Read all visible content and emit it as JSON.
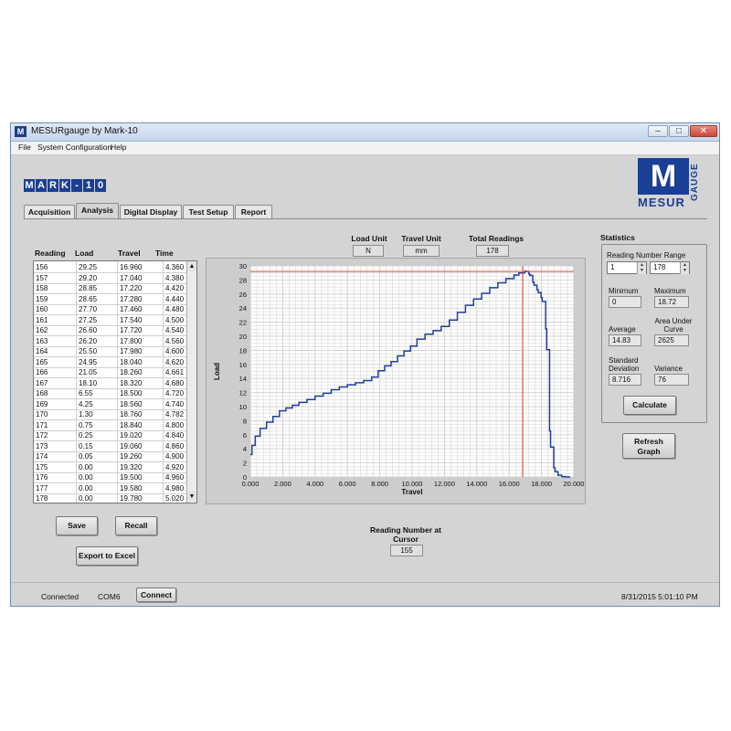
{
  "window": {
    "title": "MESURgauge by Mark-10"
  },
  "window_controls": {
    "minimize": "–",
    "maximize": "□",
    "close": "✕"
  },
  "menu": [
    "File",
    "System Configuration",
    "Help"
  ],
  "logos": {
    "mark10": [
      "M",
      "A",
      "R",
      "K",
      "-",
      "1",
      "0"
    ],
    "mesur_letter": "M",
    "mesur_word": "MESUR",
    "gauge_word": "GAUGE"
  },
  "tabs": [
    {
      "label": "Acquisition",
      "active": false
    },
    {
      "label": "Analysis",
      "active": true
    },
    {
      "label": "Digital Display",
      "active": false
    },
    {
      "label": "Test Setup",
      "active": false
    },
    {
      "label": "Report",
      "active": false
    }
  ],
  "table": {
    "headers": [
      "Reading",
      "Load",
      "Travel",
      "Time"
    ],
    "rows": [
      [
        "156",
        "29.25",
        "16.960",
        "4.360"
      ],
      [
        "157",
        "29.20",
        "17.040",
        "4.380"
      ],
      [
        "158",
        "28.85",
        "17.220",
        "4.420"
      ],
      [
        "159",
        "28.65",
        "17.280",
        "4.440"
      ],
      [
        "160",
        "27.70",
        "17.460",
        "4.480"
      ],
      [
        "161",
        "27.25",
        "17.540",
        "4.500"
      ],
      [
        "162",
        "26.60",
        "17.720",
        "4.540"
      ],
      [
        "163",
        "26.20",
        "17.800",
        "4.560"
      ],
      [
        "164",
        "25.50",
        "17.980",
        "4.600"
      ],
      [
        "165",
        "24.95",
        "18.040",
        "4.620"
      ],
      [
        "166",
        "21.05",
        "18.260",
        "4.661"
      ],
      [
        "167",
        "18.10",
        "18.320",
        "4.680"
      ],
      [
        "168",
        "6.55",
        "18.500",
        "4.720"
      ],
      [
        "169",
        "4.25",
        "18.560",
        "4.740"
      ],
      [
        "170",
        "1.30",
        "18.760",
        "4.782"
      ],
      [
        "171",
        "0.75",
        "18.840",
        "4.800"
      ],
      [
        "172",
        "0.25",
        "19.020",
        "4.840"
      ],
      [
        "173",
        "0.15",
        "19.060",
        "4.860"
      ],
      [
        "174",
        "0.05",
        "19.260",
        "4.900"
      ],
      [
        "175",
        "0.00",
        "19.320",
        "4.920"
      ],
      [
        "176",
        "0.00",
        "19.500",
        "4.960"
      ],
      [
        "177",
        "0.00",
        "19.580",
        "4.980"
      ],
      [
        "178",
        "0.00",
        "19.780",
        "5.020"
      ]
    ]
  },
  "scroll": {
    "up": "▲",
    "down": "▼"
  },
  "buttons": {
    "save": "Save",
    "recall": "Recall",
    "export": "Export to Excel",
    "calculate": "Calculate",
    "refresh": "Refresh Graph",
    "connect": "Connect"
  },
  "indicators": {
    "load_unit": {
      "label": "Load Unit",
      "value": "N"
    },
    "travel_unit": {
      "label": "Travel Unit",
      "value": "mm"
    },
    "total_readings": {
      "label": "Total Readings",
      "value": "178"
    },
    "reading_at_cursor": {
      "label": "Reading Number at Cursor",
      "value": "155"
    }
  },
  "statistics": {
    "title": "Statistics",
    "range_label": "Reading Number Range",
    "range_from": "1",
    "range_to": "178",
    "minimum": {
      "label": "Minimum",
      "value": "0"
    },
    "maximum": {
      "label": "Maximum",
      "value": "18.72"
    },
    "average": {
      "label": "Average",
      "value": "14.83"
    },
    "area": {
      "label": "Area Under Curve",
      "value": "2625"
    },
    "std_dev": {
      "label": "Standard Deviation",
      "value": "8.716"
    },
    "variance": {
      "label": "Variance",
      "value": "76"
    }
  },
  "status": {
    "connection": "Connected",
    "port": "COM6",
    "datetime": "8/31/2015 5:01:10 PM"
  },
  "colors": {
    "curve": "#1f3f9a",
    "cursor": "#e0433a",
    "grid": "#d0d0d0",
    "plot_bg": "#ffffff",
    "brand": "#1a3f95"
  },
  "chart_data": {
    "type": "line",
    "xlabel": "Travel",
    "ylabel": "Load",
    "xlim": [
      0,
      20
    ],
    "ylim": [
      0,
      30
    ],
    "x_ticks": [
      "0.000",
      "2.000",
      "4.000",
      "6.000",
      "8.000",
      "10.000",
      "12.000",
      "14.000",
      "16.000",
      "18.000",
      "20.000"
    ],
    "y_ticks": [
      "0",
      "2",
      "4",
      "6",
      "8",
      "10",
      "12",
      "14",
      "16",
      "18",
      "20",
      "22",
      "24",
      "26",
      "28",
      "30"
    ],
    "grid": true,
    "cursor": {
      "x": 16.84,
      "y": 29.2
    },
    "series": [
      {
        "x": [
          0,
          0.1,
          0.3,
          0.6,
          1.0,
          1.4,
          1.8,
          2.2,
          2.6,
          3.0,
          3.5,
          4.0,
          4.5,
          5.0,
          5.5,
          6.0,
          6.5,
          7.0,
          7.5,
          7.9,
          8.3,
          8.7,
          9.1,
          9.5,
          9.9,
          10.3,
          10.8,
          11.3,
          11.8,
          12.3,
          12.8,
          13.3,
          13.8,
          14.3,
          14.8,
          15.3,
          15.8,
          16.3,
          16.6,
          16.96,
          17.04,
          17.22,
          17.28,
          17.46,
          17.54,
          17.72,
          17.8,
          17.98,
          18.04,
          18.26,
          18.32,
          18.5,
          18.56,
          18.76,
          18.84,
          19.02,
          19.26,
          19.5,
          19.78
        ],
        "y": [
          3.2,
          4.5,
          5.8,
          6.9,
          7.8,
          8.6,
          9.4,
          9.8,
          10.2,
          10.6,
          11.0,
          11.5,
          11.9,
          12.4,
          12.8,
          13.1,
          13.4,
          13.7,
          14.2,
          15.1,
          15.8,
          16.4,
          17.2,
          17.9,
          18.6,
          19.6,
          20.3,
          20.8,
          21.4,
          22.3,
          23.4,
          24.4,
          25.3,
          26.1,
          26.9,
          27.6,
          28.2,
          28.7,
          29.0,
          29.25,
          29.2,
          28.85,
          28.65,
          27.7,
          27.25,
          26.6,
          26.2,
          25.5,
          24.95,
          21.05,
          18.1,
          6.55,
          4.25,
          1.3,
          0.75,
          0.25,
          0.05,
          0.0,
          0.0
        ]
      }
    ]
  }
}
